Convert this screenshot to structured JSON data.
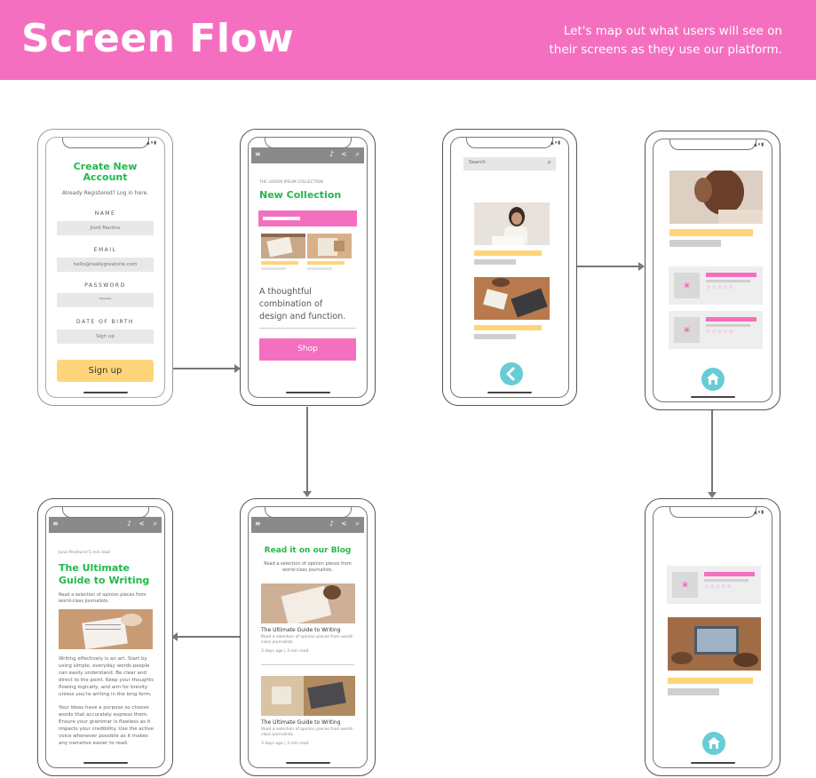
{
  "header": {
    "title": "Screen Flow",
    "subtitle_line1": "Let's map out what users will see on",
    "subtitle_line2": "their screens as they use our platform."
  },
  "signup": {
    "title_line1": "Create New",
    "title_line2": "Account",
    "already": "Already Registered? Log in here.",
    "name_label": "NAME",
    "name_value": "Jiord Martins",
    "email_label": "EMAIL",
    "email_value": "hello@reallygreatsite.com",
    "password_label": "PASSWORD",
    "password_value": "*****",
    "dob_label": "DATE OF BIRTH",
    "dob_value": "Sign up",
    "button": "Sign up"
  },
  "collection": {
    "kicker": "THE LOREM IPSUM COLLECTION",
    "title": "New Collection",
    "tagline_line1": "A thoughtful",
    "tagline_line2": "combination of",
    "tagline_line3": "design and function.",
    "button": "Shop"
  },
  "search": {
    "placeholder": "Search"
  },
  "blog": {
    "title": "Read it on our Blog",
    "subtitle_line1": "Read a selection of opinion pieces from",
    "subtitle_line2": "world-class journalists.",
    "posts": [
      {
        "title": "The Ultimate Guide to Writing",
        "desc_line1": "Read a selection of opinion pieces from world-",
        "desc_line2": "class journalists",
        "meta": "3 days ago | 3 min read"
      },
      {
        "title": "The Ultimate Guide to Writing",
        "desc_line1": "Read a selection of opinion pieces from world-",
        "desc_line2": "class journalists",
        "meta": "3 days ago | 3 min read"
      }
    ]
  },
  "article": {
    "meta": "Juno Pinehurst 5 min read",
    "title_line1": "The Ultimate",
    "title_line2": "Guide to Writing",
    "intro_line1": "Read a selection of opinion pieces from",
    "intro_line2": "world-class journalists.",
    "body1": [
      "Writing effectively is an art. Start by",
      "using simple, everyday words people",
      "can easily understand. Be clear and",
      "direct to the point. Keep your thoughts",
      "flowing logically, and aim for brevity",
      "unless you're writing in the long form."
    ],
    "body2": [
      "Your ideas have a purpose so choose",
      "words that accurately express them.",
      "Ensure your grammar is flawless as it",
      "impacts your credibility. Use the active",
      "voice whenever possible as it makes",
      "any narrative easier to read."
    ]
  },
  "colors": {
    "pink": "#f56fc0",
    "green": "#22b94c",
    "yellow": "#fed679",
    "teal": "#66ccd6"
  }
}
